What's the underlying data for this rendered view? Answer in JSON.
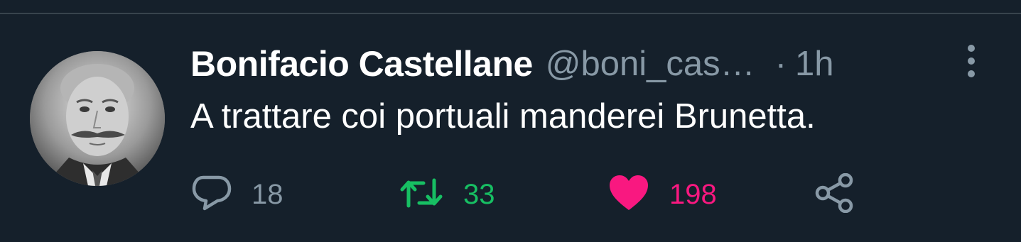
{
  "tweet": {
    "author_name": "Bonifacio Castellane",
    "author_handle": "@boni_cas…",
    "separator": "·",
    "time": "1h",
    "text": "A trattare coi portuali manderei Brunetta."
  },
  "actions": {
    "reply_count": "18",
    "retweet_count": "33",
    "like_count": "198"
  },
  "icons": {
    "reply": "reply-icon",
    "retweet": "retweet-icon",
    "like": "heart-icon",
    "share": "share-icon",
    "more": "more-vertical-icon"
  },
  "colors": {
    "background": "#15202b",
    "text_primary": "#ffffff",
    "text_secondary": "#8899a6",
    "retweet_active": "#17bf63",
    "like_active": "#f91880"
  }
}
